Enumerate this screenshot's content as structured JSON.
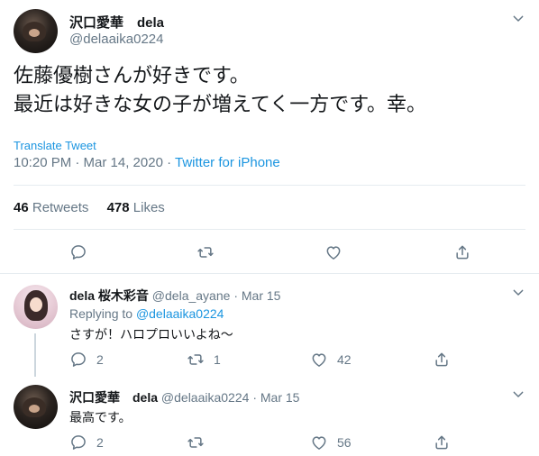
{
  "tweet": {
    "display_name": "沢口愛華　dela",
    "handle": "@delaaika0224",
    "text_line1": "佐藤優樹さんが好きです。",
    "text_line2": "最近は好きな女の子が増えてく一方です。幸。",
    "translate_label": "Translate Tweet",
    "timestamp": "10:20 PM · Mar 14, 2020",
    "separator": " · ",
    "source": "Twitter for iPhone",
    "retweets_count": "46",
    "retweets_label": "Retweets",
    "likes_count": "478",
    "likes_label": "Likes"
  },
  "replies": [
    {
      "display_name": "dela 桜木彩音",
      "handle": "@dela_ayane",
      "dot": "·",
      "date": "Mar 15",
      "replying_prefix": "Replying to",
      "replying_handle": "@delaaika0224",
      "text": "さすが！ハロプロいいよね〜",
      "reply_count": "2",
      "retweet_count": "1",
      "like_count": "42"
    },
    {
      "display_name": "沢口愛華　dela",
      "handle": "@delaaika0224",
      "dot": "·",
      "date": "Mar 15",
      "text": "最高です。",
      "reply_count": "2",
      "retweet_count": "",
      "like_count": "56"
    }
  ],
  "colors": {
    "link": "#1b95e0",
    "muted": "#657786",
    "divider": "#e6ecf0"
  },
  "icons": [
    "chevron-down-icon",
    "reply-icon",
    "retweet-icon",
    "like-icon",
    "share-icon"
  ]
}
